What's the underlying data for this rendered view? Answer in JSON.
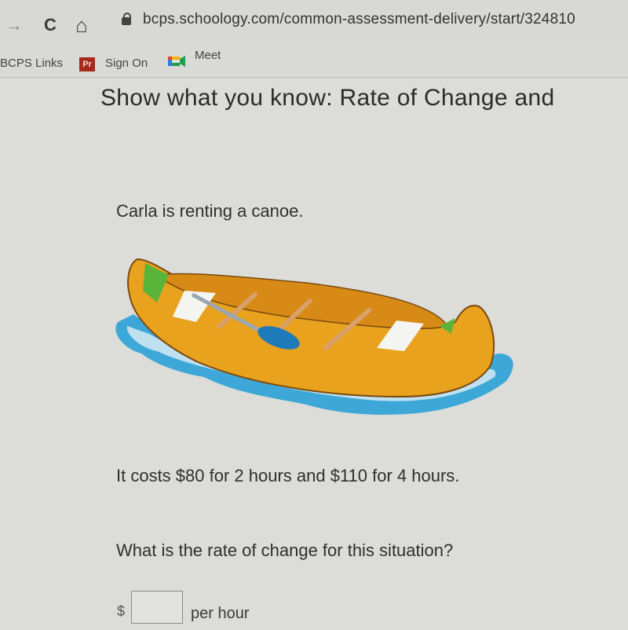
{
  "browser": {
    "url": "bcps.schoology.com/common-assessment-delivery/start/324810",
    "nav_icons": [
      "forward-icon",
      "reload-icon",
      "home-icon",
      "lock-icon"
    ],
    "nav_glyphs": {
      "forward": "→",
      "reload": "C",
      "home": "⌂"
    },
    "bookmarks": [
      {
        "label": "BCPS Links"
      },
      {
        "label": "Sign On",
        "icon": "Pr",
        "icon_color": "#a52a1c"
      },
      {
        "label": "Meet"
      }
    ]
  },
  "page": {
    "title": "Show what you know: Rate of Change and",
    "intro": "Carla is renting a canoe.",
    "image_alt": "canoe-illustration",
    "statement": "It costs $80 for 2 hours and $110 for 4 hours.",
    "question": "What is the rate of change for this situation?",
    "answer": {
      "prefix": "$",
      "value": "",
      "suffix": "per hour"
    }
  }
}
